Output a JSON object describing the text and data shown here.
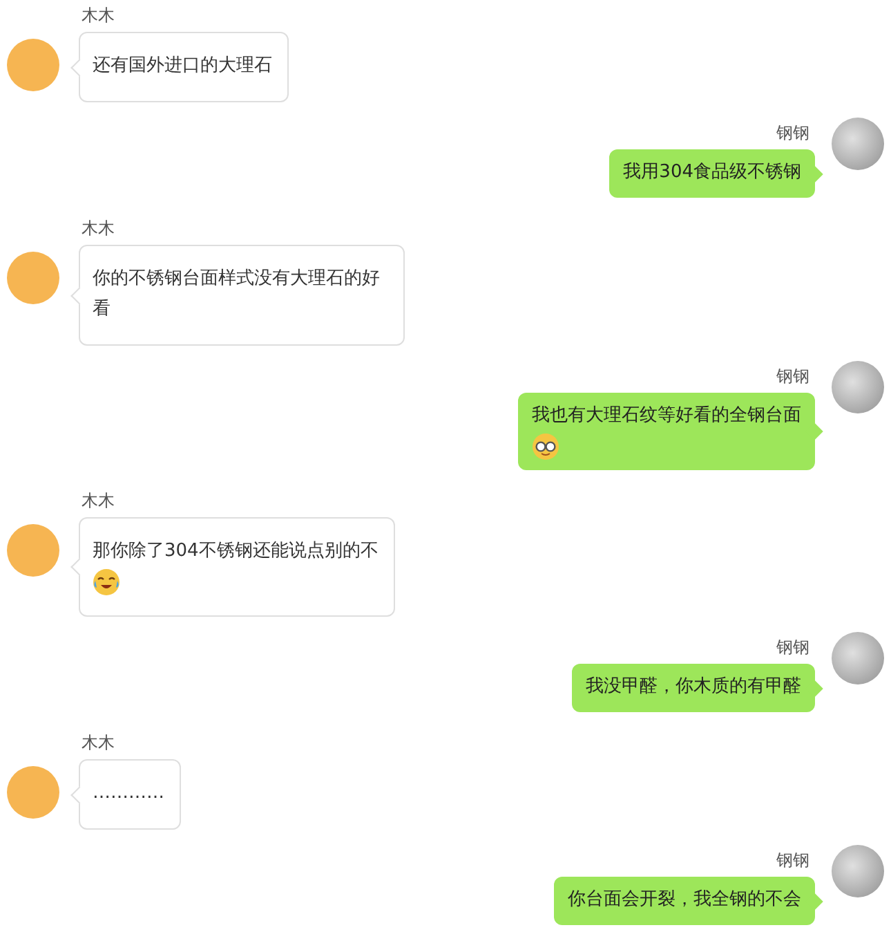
{
  "messages": [
    {
      "kind": "incoming",
      "sender": "木木",
      "text": "还有国外进口的大理石"
    },
    {
      "kind": "outgoing",
      "sender": "钢钢",
      "text": "我用304食品级不锈钢"
    },
    {
      "kind": "incoming",
      "sender": "木木",
      "text": "你的不锈钢台面样式没有大理石的好看"
    },
    {
      "kind": "outgoing",
      "sender": "钢钢",
      "text": "我也有大理石纹等好看的全钢台面",
      "emoji": true
    },
    {
      "kind": "incoming",
      "sender": "木木",
      "text": "那你除了304不锈钢还能说点别的不",
      "emoji": true
    },
    {
      "kind": "outgoing",
      "sender": "钢钢",
      "text": "我没甲醛，你木质的有甲醛"
    },
    {
      "kind": "incoming",
      "sender": "木木",
      "text": "…………"
    },
    {
      "kind": "outgoing",
      "sender": "钢钢",
      "text": "你台面会开裂，我全钢的不会"
    }
  ]
}
